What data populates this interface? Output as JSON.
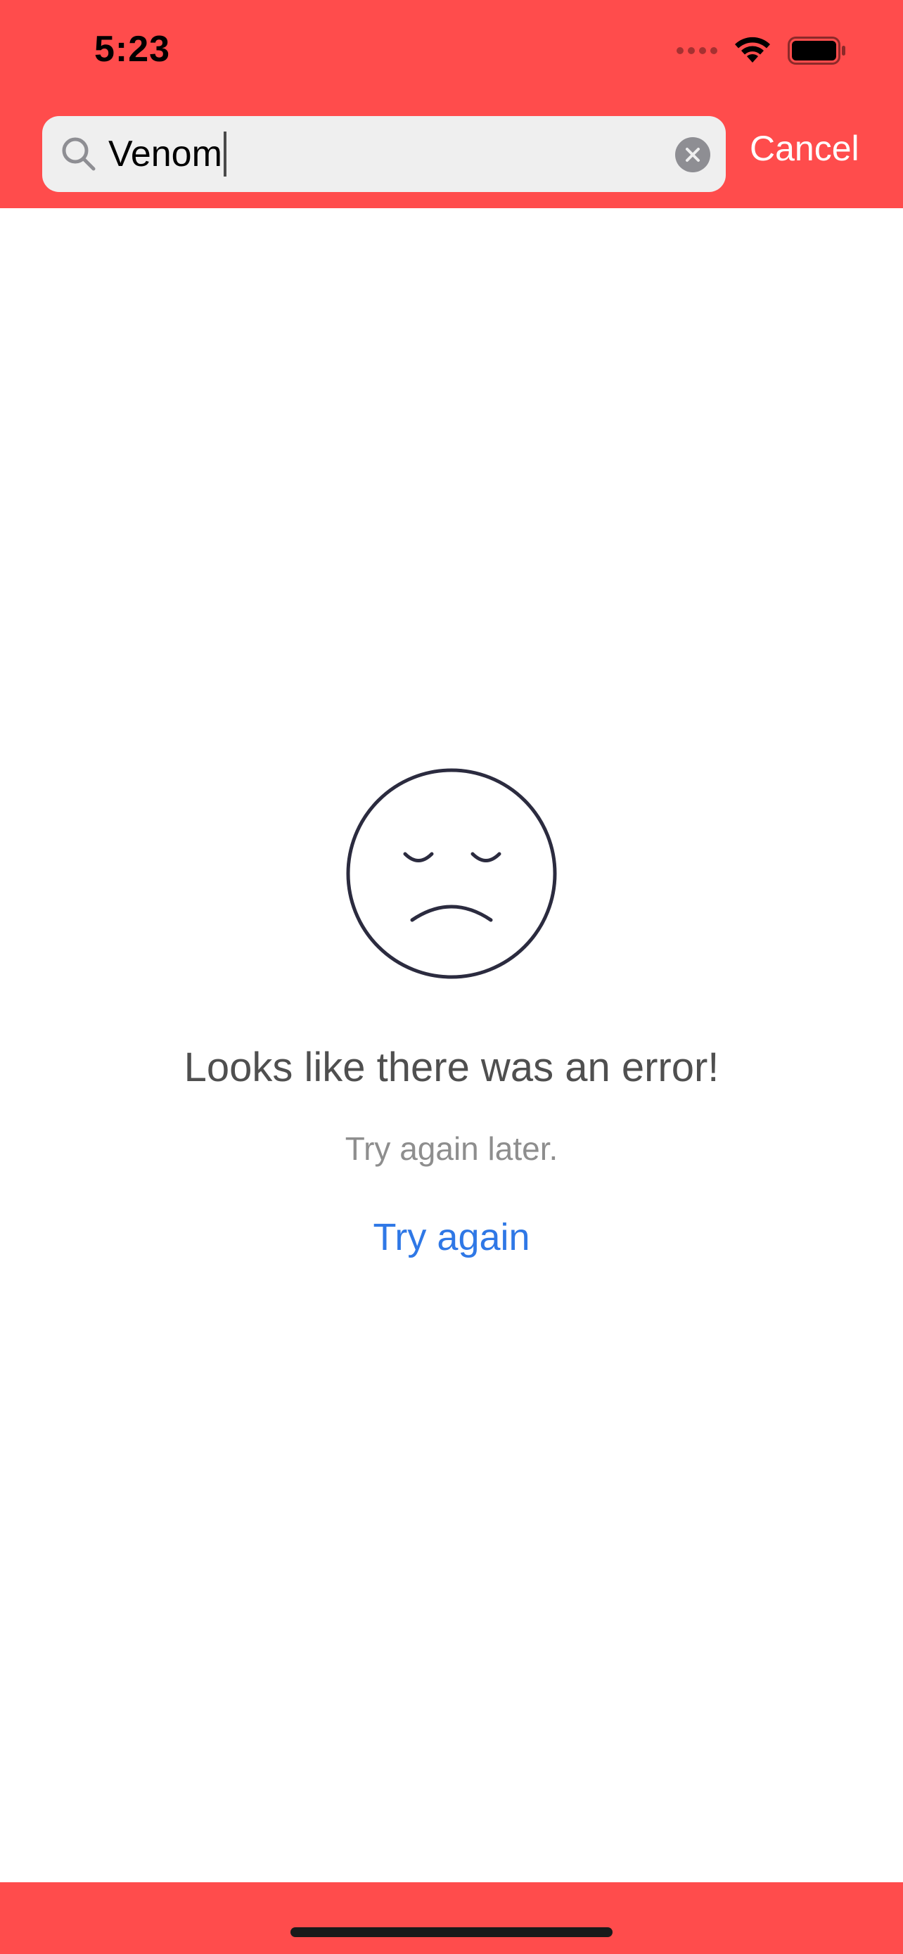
{
  "colors": {
    "accent": "#FF4C4C",
    "link": "#2F78E6",
    "title_text": "#4F4F4F",
    "subtitle_text": "#8E8E8E",
    "search_bg": "#EFEFEF",
    "face_stroke": "#2B2B3F"
  },
  "status_bar": {
    "time": "5:23",
    "icons": [
      "signal-dots-icon",
      "wifi-icon",
      "battery-icon"
    ]
  },
  "search": {
    "value": "Venom",
    "icon": "search-icon",
    "clear_icon": "clear-circle-icon",
    "cancel_label": "Cancel"
  },
  "error_state": {
    "icon": "sad-face-icon",
    "title": "Looks like there was an error!",
    "subtitle": "Try again later.",
    "retry_label": "Try again"
  }
}
